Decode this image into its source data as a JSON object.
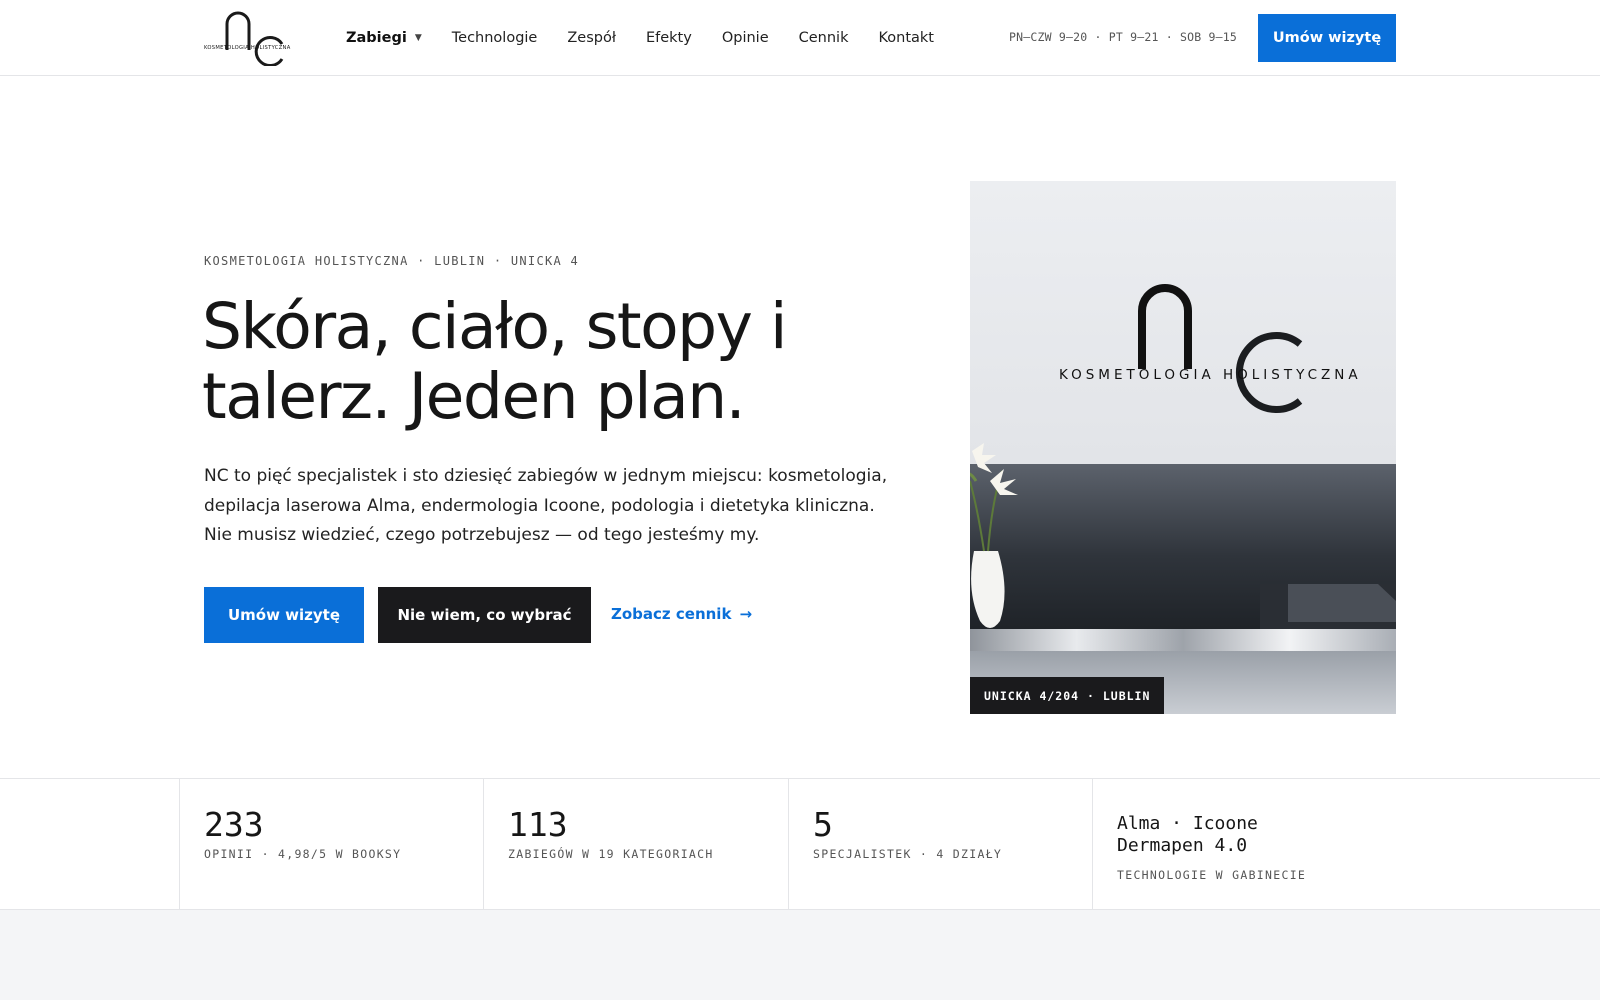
{
  "header": {
    "logo_text": "KOSMETOLOGIA HOLISTYCZNA",
    "nav": [
      {
        "label": "Zabiegi",
        "has_dropdown": true
      },
      {
        "label": "Technologie"
      },
      {
        "label": "Zespół"
      },
      {
        "label": "Efekty"
      },
      {
        "label": "Opinie"
      },
      {
        "label": "Cennik"
      },
      {
        "label": "Kontakt"
      }
    ],
    "hours": "PN–CZW 9–20 · PT 9–21 · SOB 9–15",
    "cta_label": "Umów wizytę"
  },
  "hero": {
    "eyebrow": "KOSMETOLOGIA HOLISTYCZNA · LUBLIN · UNICKA 4",
    "title_line1": "Skóra, ciało, stopy i",
    "title_line2": "talerz. Jeden plan.",
    "description": "NC to pięć specjalistek i sto dziesięć zabiegów w jednym miejscu: kosmetologia, depilacja laserowa Alma, endermologia Icoone, podologia i dietetyka kliniczna. Nie musisz wiedzieć, czego potrzebujesz — od tego jesteśmy my.",
    "primary_button": "Umów wizytę",
    "secondary_button": "Nie wiem, co wybrać",
    "link_label": "Zobacz cennik",
    "link_arrow": "→",
    "image_logo_text": "KOSMETOLOGIA HOLISTYCZNA",
    "image_caption": "UNICKA 4/204 · LUBLIN"
  },
  "stats": [
    {
      "value": "233",
      "label": "OPINII · 4,98/5 W BOOKSY"
    },
    {
      "value": "113",
      "label": "ZABIEGÓW W 19 KATEGORIACH"
    },
    {
      "value": "5",
      "label": "SPECJALISTEK · 4 DZIAŁY"
    }
  ],
  "tech": {
    "line1": "Alma · Icoone",
    "line2": "Dermapen 4.0",
    "label": "TECHNOLOGIE W GABINECIE"
  },
  "colors": {
    "accent": "#0a6fd8",
    "dark": "#1a1a1c",
    "border": "#e4e5e8",
    "band": "#f4f5f7"
  }
}
